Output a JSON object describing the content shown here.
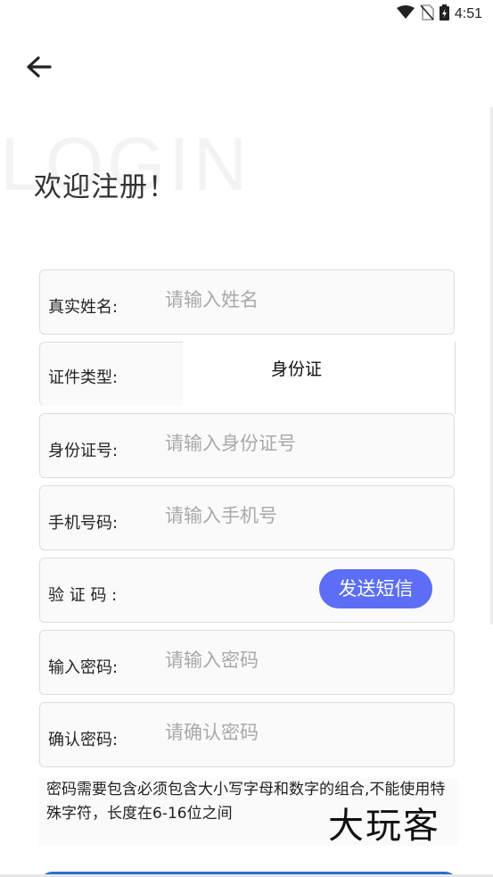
{
  "status_bar": {
    "time": "4:51",
    "icons": [
      "wifi-icon",
      "no-sim-icon",
      "battery-charging-icon"
    ]
  },
  "header": {
    "back_icon": "arrow-left-icon",
    "watermark": "LOGIN",
    "title": "欢迎注册！"
  },
  "form": {
    "name": {
      "label": "真实姓名:",
      "placeholder": "请输入姓名"
    },
    "id_type": {
      "label": "证件类型:",
      "value": "身份证"
    },
    "id_number": {
      "label": "身份证号:",
      "placeholder": "请输入身份证号"
    },
    "phone": {
      "label": "手机号码:",
      "placeholder": "请输入手机号"
    },
    "code": {
      "label": "验 证 码 :",
      "button": "发送短信",
      "button_color": "#5b6ef5"
    },
    "password": {
      "label": "输入密码:",
      "placeholder": "请输入密码"
    },
    "confirm": {
      "label": "确认密码:",
      "placeholder": "请确认密码"
    }
  },
  "note": "密码需要包含必须包含大小写字母和数字的组合,不能使用特殊字符，长度在6-16位之间",
  "brand": "大玩客"
}
